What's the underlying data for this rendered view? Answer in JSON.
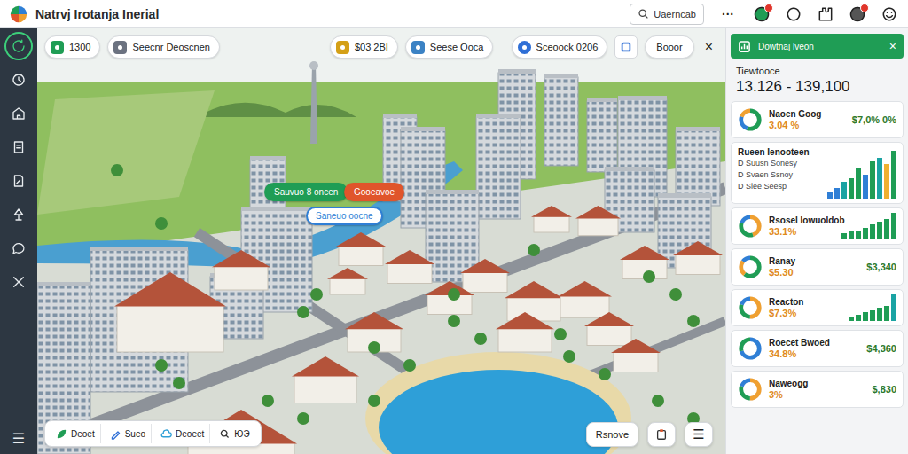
{
  "window": {
    "title": "Natrvj Irotanja Inerial"
  },
  "topbar": {
    "search": {
      "value": "Uaerncab"
    },
    "more": "···",
    "icons": [
      {
        "badge": true
      },
      {
        "badge": false
      },
      {
        "badge": false
      },
      {
        "badge": true
      },
      {
        "badge": false
      }
    ]
  },
  "sidebar": {
    "items": [
      {
        "selected": true
      },
      {
        "selected": false
      },
      {
        "selected": false
      },
      {
        "selected": false
      },
      {
        "selected": false
      },
      {
        "selected": false
      },
      {
        "selected": false
      },
      {
        "selected": false
      }
    ],
    "menu": "☰"
  },
  "map": {
    "chips": [
      {
        "label": "1300",
        "color": "#1f9d55"
      },
      {
        "label": "Seecnr Deoscnen",
        "color": "#6b7280"
      },
      {
        "label": "$03 2BI",
        "color": "#d4a017"
      },
      {
        "label": "Seese Ooca",
        "color": "#3b82c4"
      }
    ],
    "view_chip": {
      "label": "Sceoock 0206",
      "color": "#2f6fd6"
    },
    "layer_button": {
      "label": "Booor"
    },
    "close": "×",
    "pins": [
      {
        "label": "Sauvuo 8 oncen",
        "color": "#1f9d55",
        "kind": "filled"
      },
      {
        "label": "Gooeavoe",
        "color": "#e0552b",
        "kind": "filled"
      },
      {
        "label": "Saneuo oocne",
        "color": "#2f7fd6",
        "kind": "outline"
      }
    ],
    "tools": [
      {
        "label": "Deoet",
        "color": "#1f9d55"
      },
      {
        "label": "Sueo",
        "color": "#2f6fd6"
      },
      {
        "label": "Deoeet",
        "color": "#2f9fd6"
      },
      {
        "label": "ЮЭ",
        "color": "#333333"
      }
    ],
    "actions": {
      "primary": "Rsnove",
      "menu": "☰"
    }
  },
  "panel": {
    "title": "Dowtnaj lveon",
    "close": "×",
    "summary": {
      "label": "Tiewtooce",
      "value": "13.126 - 139,100"
    },
    "cards": [
      {
        "kind": "stat",
        "title": "Naoen Goog",
        "segments": [
          {
            "share": 0.55,
            "color": "#1f9d55"
          },
          {
            "share": 0.25,
            "color": "#2f7fd6"
          },
          {
            "share": 0.2,
            "color": "#f0a030"
          }
        ],
        "value": "3.04 %",
        "amount": "$7,0% 0%"
      },
      {
        "kind": "legend",
        "title": "Rueen Ienooteen",
        "legend": [
          "D Suusn Sonesy",
          "D Svaen Ssnoy",
          "D Siee Seesp"
        ],
        "bars": {
          "values": [
            2,
            3,
            5,
            6,
            9,
            7,
            11,
            12,
            10,
            14
          ],
          "colors": [
            "#2f7fd6",
            "#2f7fd6",
            "#1aa3a3",
            "#1f9d55",
            "#1f9d55",
            "#2f7fd6",
            "#1f9d55",
            "#1aa3a3",
            "#f0b030",
            "#1f9d55"
          ]
        }
      },
      {
        "kind": "bars",
        "title": "Rsosel Iowuoldob",
        "segments": [
          {
            "share": 0.45,
            "color": "#f0a030"
          },
          {
            "share": 0.35,
            "color": "#1f9d55"
          },
          {
            "share": 0.2,
            "color": "#2f7fd6"
          }
        ],
        "value": "33.1%",
        "bars": {
          "values": [
            2,
            3,
            3,
            4,
            5,
            6,
            7,
            9
          ],
          "colors": [
            "#1f9d55",
            "#1f9d55",
            "#1f9d55",
            "#1f9d55",
            "#1f9d55",
            "#1f9d55",
            "#1f9d55",
            "#1f9d55"
          ]
        }
      },
      {
        "kind": "stat",
        "title": "Ranay",
        "segments": [
          {
            "share": 0.6,
            "color": "#1f9d55"
          },
          {
            "share": 0.25,
            "color": "#f0a030"
          },
          {
            "share": 0.15,
            "color": "#2f7fd6"
          }
        ],
        "value": "$5.30",
        "amount": "$3,340"
      },
      {
        "kind": "bars",
        "title": "Reacton",
        "segments": [
          {
            "share": 0.5,
            "color": "#f0a030"
          },
          {
            "share": 0.3,
            "color": "#1f9d55"
          },
          {
            "share": 0.2,
            "color": "#2f7fd6"
          }
        ],
        "value": "$7.3%",
        "bars": {
          "values": [
            2,
            3,
            4,
            5,
            6,
            7,
            12
          ],
          "colors": [
            "#1f9d55",
            "#1f9d55",
            "#1f9d55",
            "#1f9d55",
            "#1f9d55",
            "#1f9d55",
            "#1aa3a3"
          ]
        }
      },
      {
        "kind": "stat",
        "title": "Roecet Bwoed",
        "segments": [
          {
            "share": 0.7,
            "color": "#2f7fd6"
          },
          {
            "share": 0.3,
            "color": "#1f9d55"
          }
        ],
        "value": "34.8%",
        "amount": "$4,360"
      },
      {
        "kind": "stat",
        "title": "Naweogg",
        "segments": [
          {
            "share": 0.5,
            "color": "#f0a030"
          },
          {
            "share": 0.3,
            "color": "#1f9d55"
          },
          {
            "share": 0.2,
            "color": "#2f7fd6"
          }
        ],
        "value": "3%",
        "amount": "$,830"
      }
    ]
  }
}
